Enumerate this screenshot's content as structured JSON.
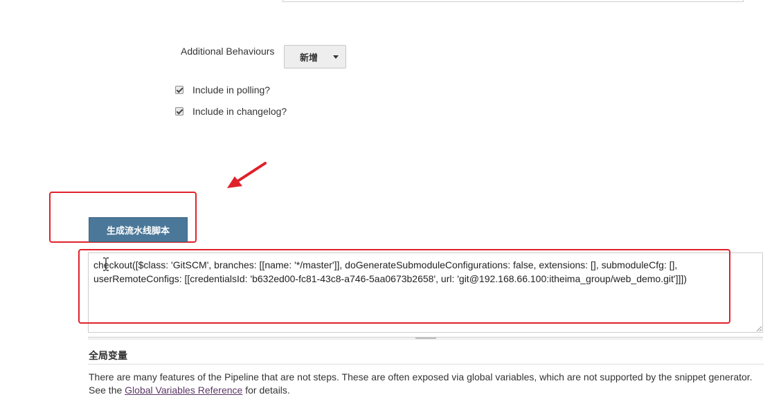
{
  "scm": {
    "additional_behaviours_label": "Additional Behaviours",
    "add_button_label": "新增",
    "include_polling_label": "Include in polling?",
    "include_polling_checked": true,
    "include_changelog_label": "Include in changelog?",
    "include_changelog_checked": true
  },
  "generator": {
    "generate_button_label": "生成流水线脚本",
    "script_text": "checkout([$class: 'GitSCM', branches: [[name: '*/master']], doGenerateSubmoduleConfigurations: false, extensions: [], submoduleCfg: [], userRemoteConfigs: [[credentialsId: 'b632ed00-fc81-43c8-a746-5aa0673b2658', url: 'git@192.168.66.100:itheima_group/web_demo.git']]])"
  },
  "globals": {
    "heading": "全局变量",
    "description_before": "There are many features of the Pipeline that are not steps. These are often exposed via global variables, which are not supported by the snippet generator. See the ",
    "link_label": "Global Variables Reference",
    "description_after": " for details."
  },
  "colors": {
    "annotation_red": "#e0202a",
    "button_blue": "#4b7899",
    "link_purple": "#5c3566"
  },
  "icons": {
    "annotation_arrow": "red-arrow-icon",
    "text_cursor": "ibeam-cursor-icon",
    "resize_grip": "resize-grip-icon",
    "dropdown_caret": "caret-down-icon",
    "checkbox": "checkbox-checked-icon"
  }
}
